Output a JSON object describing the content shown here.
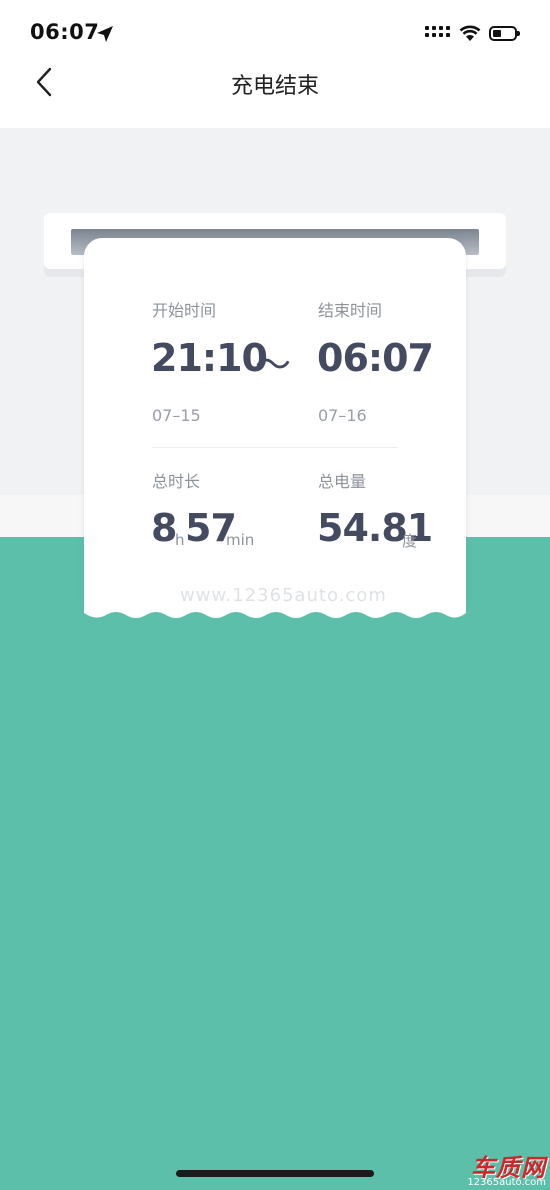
{
  "status_bar": {
    "time": "06:07",
    "icons": [
      "location-arrow-icon",
      "signal-icon",
      "wifi-icon",
      "battery-icon"
    ]
  },
  "nav": {
    "back_icon": "chevron-left-icon",
    "title": "充电结束"
  },
  "receipt": {
    "start_label": "开始时间",
    "start_time": "21:10",
    "start_date": "07–15",
    "separator": "～",
    "end_label": "结束时间",
    "end_time": "06:07",
    "end_date": "07–16",
    "duration_label": "总时长",
    "duration_hours": "8",
    "duration_hours_unit": "h",
    "duration_minutes": "57",
    "duration_minutes_unit": "min",
    "energy_label": "总电量",
    "energy_value": "54.81",
    "energy_unit": "度"
  },
  "watermark": "www.12365auto.com",
  "corner_logo": {
    "main": "车质网",
    "sub": "12365auto.com"
  },
  "colors": {
    "teal_background": "#5bbfa9",
    "number_text": "#444b60",
    "label_text": "#8e939b"
  }
}
